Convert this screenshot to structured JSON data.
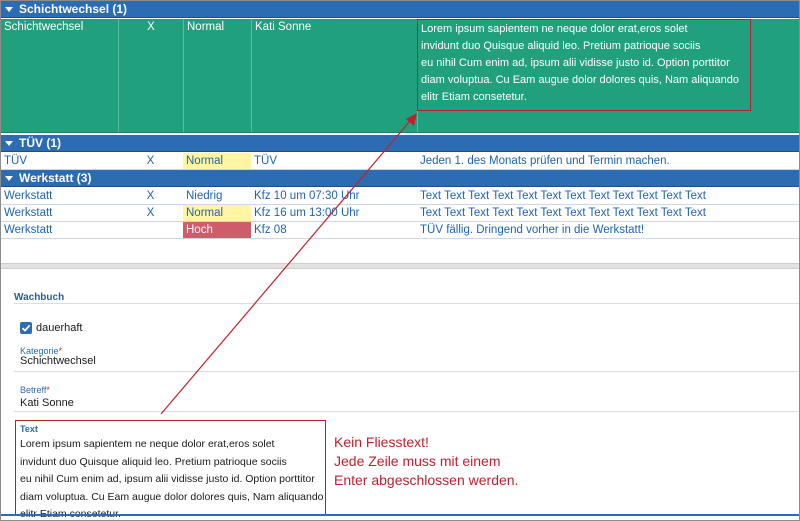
{
  "grid": {
    "groups": [
      {
        "title": "Schichtwechsel (1)",
        "rows": [
          {
            "kategorie": "Schichtwechsel",
            "dauerhaft": "X",
            "prioritaet": "Normal",
            "betreff": "Kati Sonne",
            "text": "Lorem ipsum sapientem ne neque dolor erat,eros solet\ninvidunt duo Quisque aliquid leo. Pretium patrioque sociis\neu nihil Cum enim ad, ipsum alii vidisse justo id. Option porttitor\ndiam voluptua. Cu Eam augue dolor dolores quis, Nam aliquando\nelitr Etiam consetetur."
          }
        ]
      },
      {
        "title": "TÜV (1)",
        "rows": [
          {
            "kategorie": "TÜV",
            "dauerhaft": "X",
            "prioritaet": "Normal",
            "betreff": "TÜV",
            "text": "Jeden 1. des Monats prüfen und Termin machen."
          }
        ]
      },
      {
        "title": "Werkstatt (3)",
        "rows": [
          {
            "kategorie": "Werkstatt",
            "dauerhaft": "X",
            "prioritaet": "Niedrig",
            "betreff": "Kfz 10 um 07:30 Uhr",
            "text": "Text Text Text Text Text Text Text Text Text Text Text Text"
          },
          {
            "kategorie": "Werkstatt",
            "dauerhaft": "X",
            "prioritaet": "Normal",
            "betreff": "Kfz 16 um 13:00 Uhr",
            "text": "Text Text Text Text Text Text Text Text Text Text Text Text"
          },
          {
            "kategorie": "Werkstatt",
            "dauerhaft": "",
            "prioritaet": "Hoch",
            "betreff": "Kfz 08",
            "text": "TÜV fällig. Dringend vorher in die Werkstatt!"
          }
        ]
      }
    ]
  },
  "form": {
    "title": "Wachbuch",
    "dauerhaft_label": "dauerhaft",
    "dauerhaft_checked": true,
    "kategorie_label": "Kategorie",
    "kategorie_value": "Schichtwechsel",
    "betreff_label": "Betreff",
    "betreff_value": "Kati Sonne",
    "required_marker": "*",
    "text_label": "Text",
    "text_value": "Lorem ipsum sapientem ne neque dolor erat,eros solet\ninvidunt duo Quisque aliquid leo. Pretium patrioque sociis\neu nihil Cum enim ad, ipsum alii vidisse justo id. Option porttitor\ndiam voluptua. Cu Eam augue dolor dolores quis, Nam aliquando\nelitr Etiam consetetur."
  },
  "annotation": {
    "text": "Kein Fliesstext!\nJede Zeile muss mit einem\nEnter abgeschlossen werden."
  },
  "colors": {
    "group_header": "#2b6cb3",
    "selected_row": "#21a07d",
    "priority_normal": "#fff5a3",
    "priority_hoch": "#cf5c6b",
    "annotation": "#c0202e"
  }
}
